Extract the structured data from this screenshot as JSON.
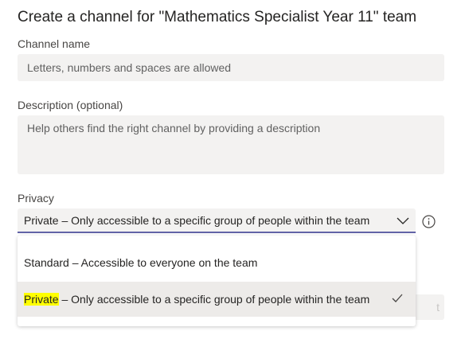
{
  "dialog": {
    "title": "Create a channel for \"Mathematics Specialist Year 11\" team"
  },
  "channel_name": {
    "label": "Channel name",
    "placeholder": "Letters, numbers and spaces are allowed"
  },
  "description": {
    "label": "Description (optional)",
    "placeholder": "Help others find the right channel by providing a description"
  },
  "privacy": {
    "label": "Privacy",
    "selected": "Private – Only accessible to a specific group of people within the team",
    "options": [
      {
        "label": "Standard – Accessible to everyone on the team"
      },
      {
        "highlight": "Private",
        "rest": " – Only accessible to a specific group of people within the team",
        "selected": true
      }
    ]
  },
  "background_button": {
    "partial_label": "t"
  },
  "icons": [
    "chevron-down-icon",
    "info-icon",
    "checkmark-icon"
  ],
  "colors": {
    "accent": "#6264a7",
    "field_bg": "#f3f2f1",
    "highlight": "#ffff00",
    "hover_bg": "#edebe9"
  }
}
